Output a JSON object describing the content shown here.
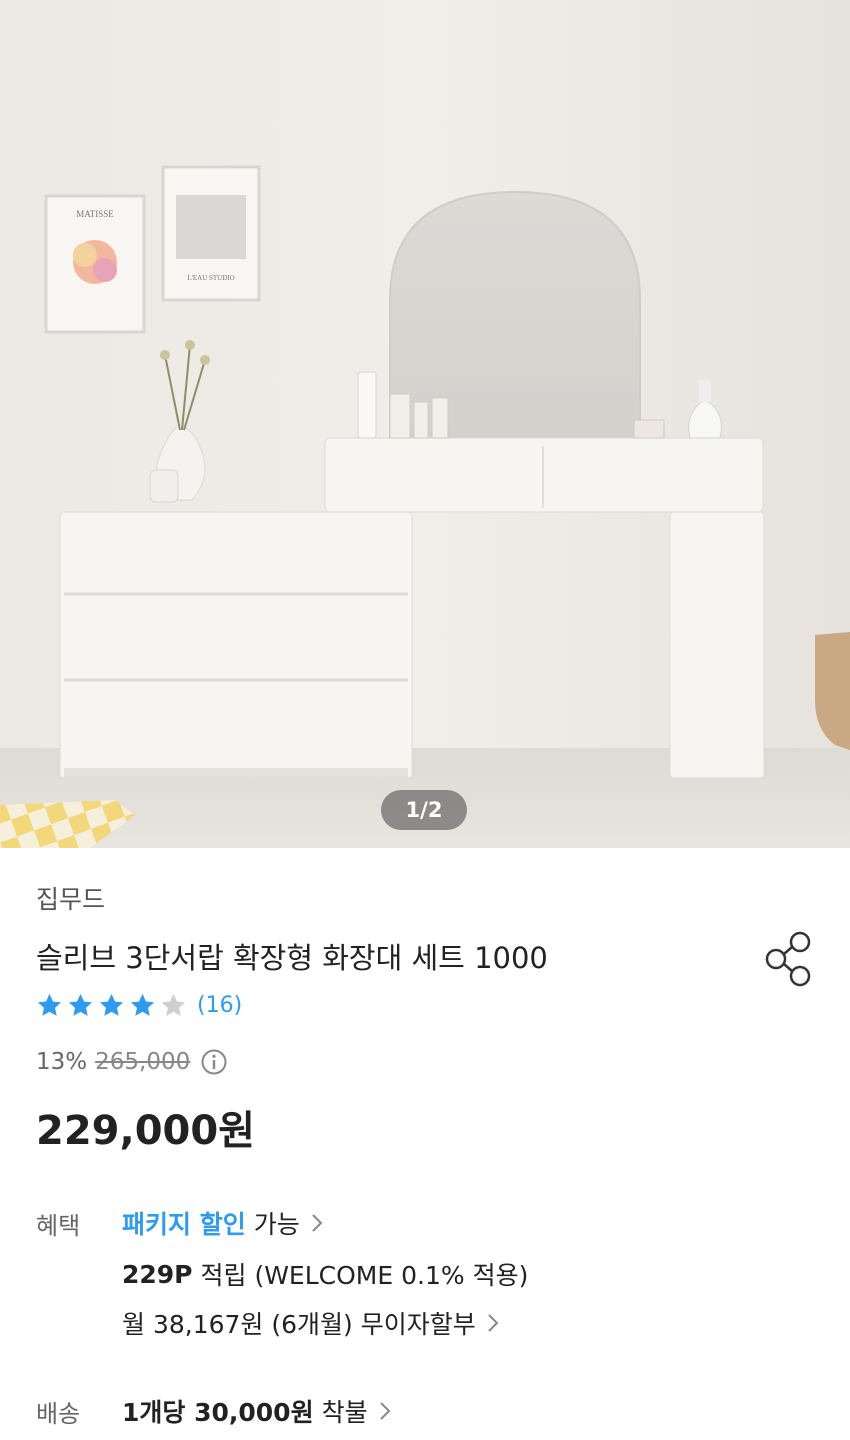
{
  "image": {
    "counter": "1/2",
    "poster1_text": "MATISSE",
    "poster2_text": "L'EAU STUDIO"
  },
  "product": {
    "brand": "집무드",
    "title": "슬리브 3단서랍 확장형 화장대 세트 1000",
    "rating": 4.5,
    "review_count": "(16)",
    "discount_rate": "13%",
    "original_price": "265,000",
    "price": "229,000원"
  },
  "benefits": {
    "label": "혜택",
    "package_link": "패키지 할인",
    "package_suffix": "가능",
    "points_bold": "229P",
    "points_text": "적립 (WELCOME 0.1% 적용)",
    "installment": "월 38,167원 (6개월) 무이자할부"
  },
  "shipping": {
    "label": "배송",
    "fee_bold": "1개당 30,000원",
    "fee_suffix": "착불"
  },
  "colors": {
    "accent": "#2f9bf0",
    "star_empty": "#cfcfcf"
  },
  "icons": [
    "share-icon",
    "star-icon",
    "info-icon",
    "chevron-right-icon"
  ]
}
